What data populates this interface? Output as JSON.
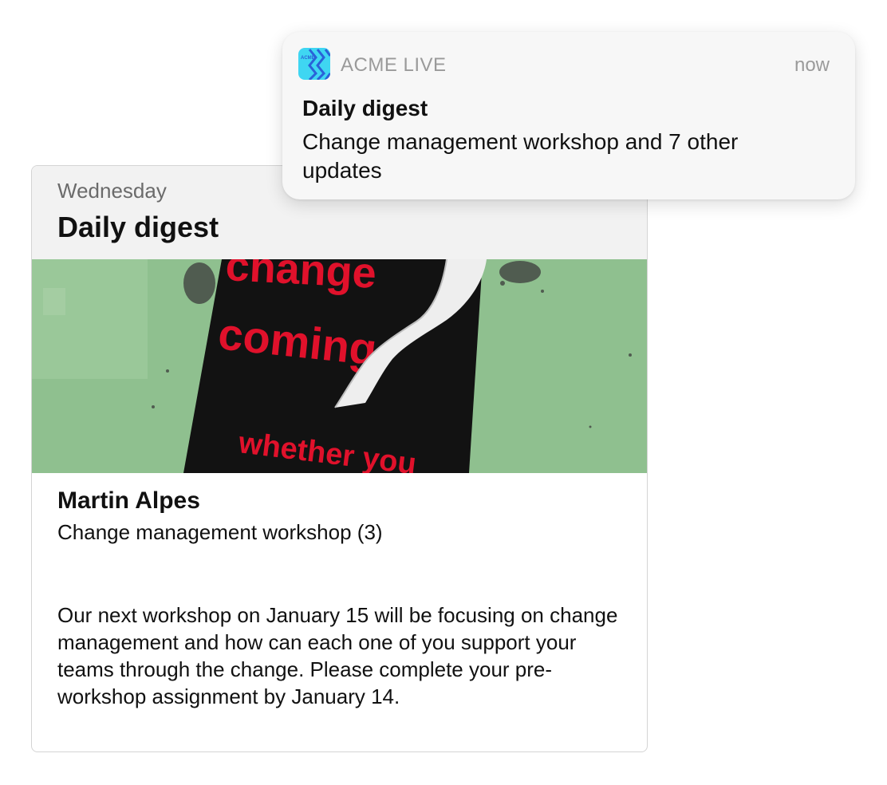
{
  "notification": {
    "app_name": "ACME LIVE",
    "app_icon": "acme-live-app-icon",
    "app_icon_text": "ACME",
    "time": "now",
    "title": "Daily digest",
    "body": "Change management workshop and 7 other updates"
  },
  "digest_card": {
    "day": "Wednesday",
    "title": "Daily digest",
    "image": {
      "description_icon": "poster-photo",
      "poster_lines": [
        "change",
        "coming,",
        "whether you"
      ]
    },
    "author": "Martin Alpes",
    "subject": "Change management workshop (3)",
    "body": "Our next workshop on January 15 will be focusing on change management and how can each one of you support your teams through the change. Please complete your pre-workshop assignment by January 14."
  },
  "colors": {
    "wall_green": "#8fc08f",
    "poster_black": "#121212",
    "poster_red": "#e0112b",
    "icon_cyan": "#3fd6f2",
    "icon_blue": "#2a62d8"
  }
}
